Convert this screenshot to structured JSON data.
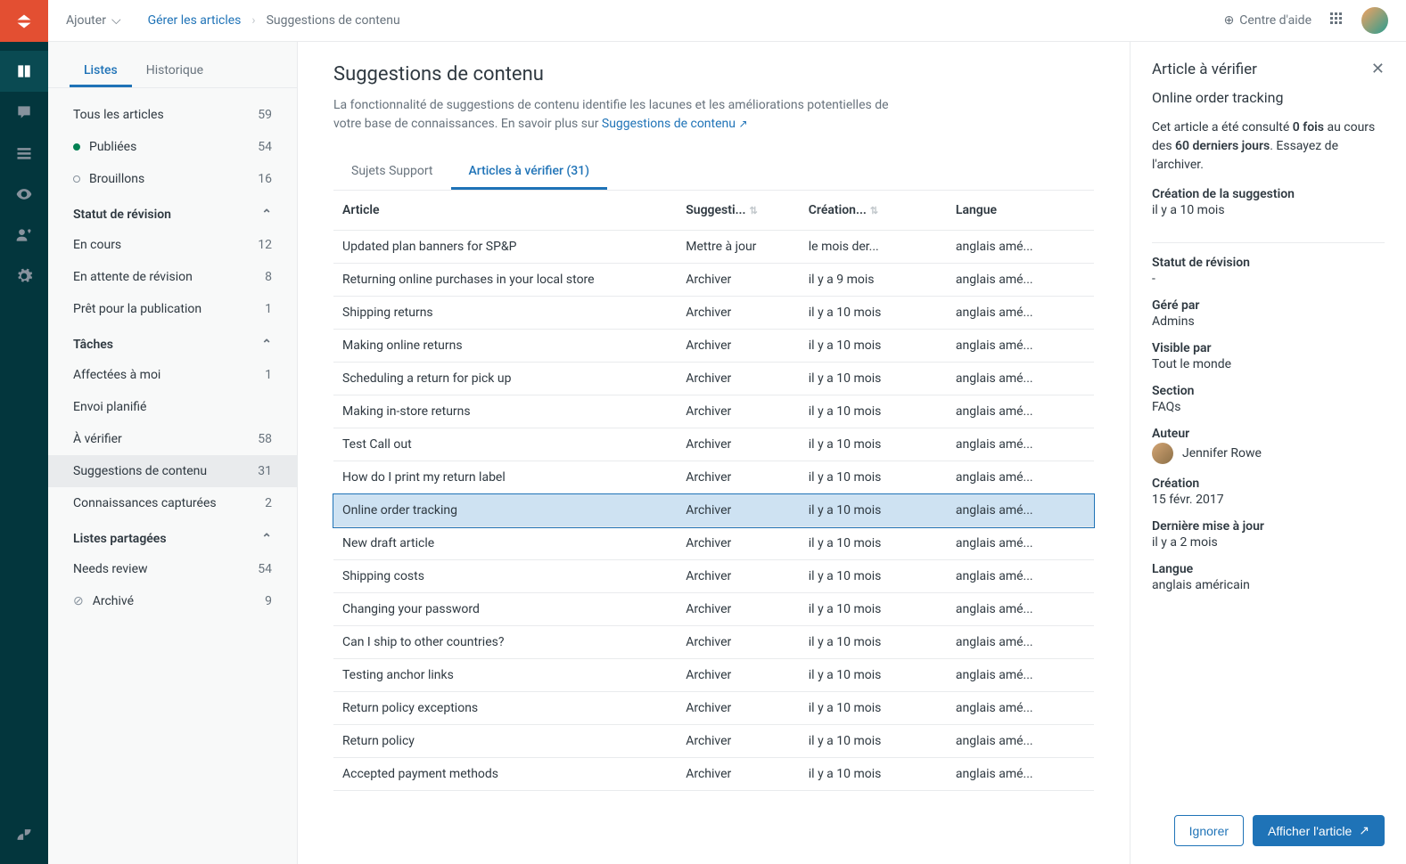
{
  "topbar": {
    "add": "Ajouter",
    "breadcrumb_link": "Gérer les articles",
    "breadcrumb_current": "Suggestions de contenu",
    "help": "Centre d'aide"
  },
  "sidebar": {
    "tab_lists": "Listes",
    "tab_history": "Historique",
    "all_articles": {
      "label": "Tous les articles",
      "count": "59"
    },
    "published": {
      "label": "Publiées",
      "count": "54"
    },
    "drafts": {
      "label": "Brouillons",
      "count": "16"
    },
    "review_header": "Statut de révision",
    "in_progress": {
      "label": "En cours",
      "count": "12"
    },
    "awaiting": {
      "label": "En attente de révision",
      "count": "8"
    },
    "ready": {
      "label": "Prêt pour la publication",
      "count": "1"
    },
    "tasks_header": "Tâches",
    "assigned": {
      "label": "Affectées à moi",
      "count": "1"
    },
    "scheduled": {
      "label": "Envoi planifié",
      "count": ""
    },
    "verify": {
      "label": "À vérifier",
      "count": "58"
    },
    "suggestions": {
      "label": "Suggestions de contenu",
      "count": "31"
    },
    "captured": {
      "label": "Connaissances capturées",
      "count": "2"
    },
    "shared_header": "Listes partagées",
    "needs_review": {
      "label": "Needs review",
      "count": "54"
    },
    "archived": {
      "label": "Archivé",
      "count": "9"
    }
  },
  "center": {
    "title": "Suggestions de contenu",
    "desc_text": "La fonctionnalité de suggestions de contenu identifie les lacunes et les améliorations potentielles de votre base de connaissances. En savoir plus sur ",
    "desc_link": "Suggestions de contenu",
    "tab_support": "Sujets Support",
    "tab_verify": "Articles à vérifier (31)",
    "headers": {
      "article": "Article",
      "suggestion": "Suggesti...",
      "creation": "Création...",
      "language": "Langue"
    },
    "rows": [
      {
        "article": "Updated plan banners for SP&P",
        "sugg": "Mettre à jour",
        "date": "le mois der...",
        "lang": "anglais amé..."
      },
      {
        "article": "Returning online purchases in your local store",
        "sugg": "Archiver",
        "date": "il y a 9 mois",
        "lang": "anglais amé..."
      },
      {
        "article": "Shipping returns",
        "sugg": "Archiver",
        "date": "il y a 10 mois",
        "lang": "anglais amé..."
      },
      {
        "article": "Making online returns",
        "sugg": "Archiver",
        "date": "il y a 10 mois",
        "lang": "anglais amé..."
      },
      {
        "article": "Scheduling a return for pick up",
        "sugg": "Archiver",
        "date": "il y a 10 mois",
        "lang": "anglais amé..."
      },
      {
        "article": "Making in-store returns",
        "sugg": "Archiver",
        "date": "il y a 10 mois",
        "lang": "anglais amé..."
      },
      {
        "article": "Test Call out",
        "sugg": "Archiver",
        "date": "il y a 10 mois",
        "lang": "anglais amé..."
      },
      {
        "article": "How do I print my return label",
        "sugg": "Archiver",
        "date": "il y a 10 mois",
        "lang": "anglais amé..."
      },
      {
        "article": "Online order tracking",
        "sugg": "Archiver",
        "date": "il y a 10 mois",
        "lang": "anglais amé...",
        "selected": true
      },
      {
        "article": "New draft article",
        "sugg": "Archiver",
        "date": "il y a 10 mois",
        "lang": "anglais amé..."
      },
      {
        "article": "Shipping costs",
        "sugg": "Archiver",
        "date": "il y a 10 mois",
        "lang": "anglais amé..."
      },
      {
        "article": "Changing your password",
        "sugg": "Archiver",
        "date": "il y a 10 mois",
        "lang": "anglais amé..."
      },
      {
        "article": "Can I ship to other countries?",
        "sugg": "Archiver",
        "date": "il y a 10 mois",
        "lang": "anglais amé..."
      },
      {
        "article": "Testing anchor links",
        "sugg": "Archiver",
        "date": "il y a 10 mois",
        "lang": "anglais amé..."
      },
      {
        "article": "Return policy exceptions",
        "sugg": "Archiver",
        "date": "il y a 10 mois",
        "lang": "anglais amé..."
      },
      {
        "article": "Return policy",
        "sugg": "Archiver",
        "date": "il y a 10 mois",
        "lang": "anglais amé..."
      },
      {
        "article": "Accepted payment methods",
        "sugg": "Archiver",
        "date": "il y a 10 mois",
        "lang": "anglais amé..."
      }
    ]
  },
  "detail": {
    "heading": "Article à vérifier",
    "title": "Online order tracking",
    "info_p1": "Cet article a été consulté ",
    "info_b1": "0 fois",
    "info_p2": " au cours des ",
    "info_b2": "60 derniers jours",
    "info_p3": ". Essayez de l'archiver.",
    "sugg_created_k": "Création de la suggestion",
    "sugg_created_v": "il y a 10 mois",
    "status_k": "Statut de révision",
    "status_v": "-",
    "managed_k": "Géré par",
    "managed_v": "Admins",
    "visible_k": "Visible par",
    "visible_v": "Tout le monde",
    "section_k": "Section",
    "section_v": "FAQs",
    "author_k": "Auteur",
    "author_v": "Jennifer Rowe",
    "created_k": "Création",
    "created_v": "15 févr. 2017",
    "updated_k": "Dernière mise à jour",
    "updated_v": "il y a 2 mois",
    "lang_k": "Langue",
    "lang_v": "anglais américain",
    "btn_ignore": "Ignorer",
    "btn_show": "Afficher l'article"
  }
}
